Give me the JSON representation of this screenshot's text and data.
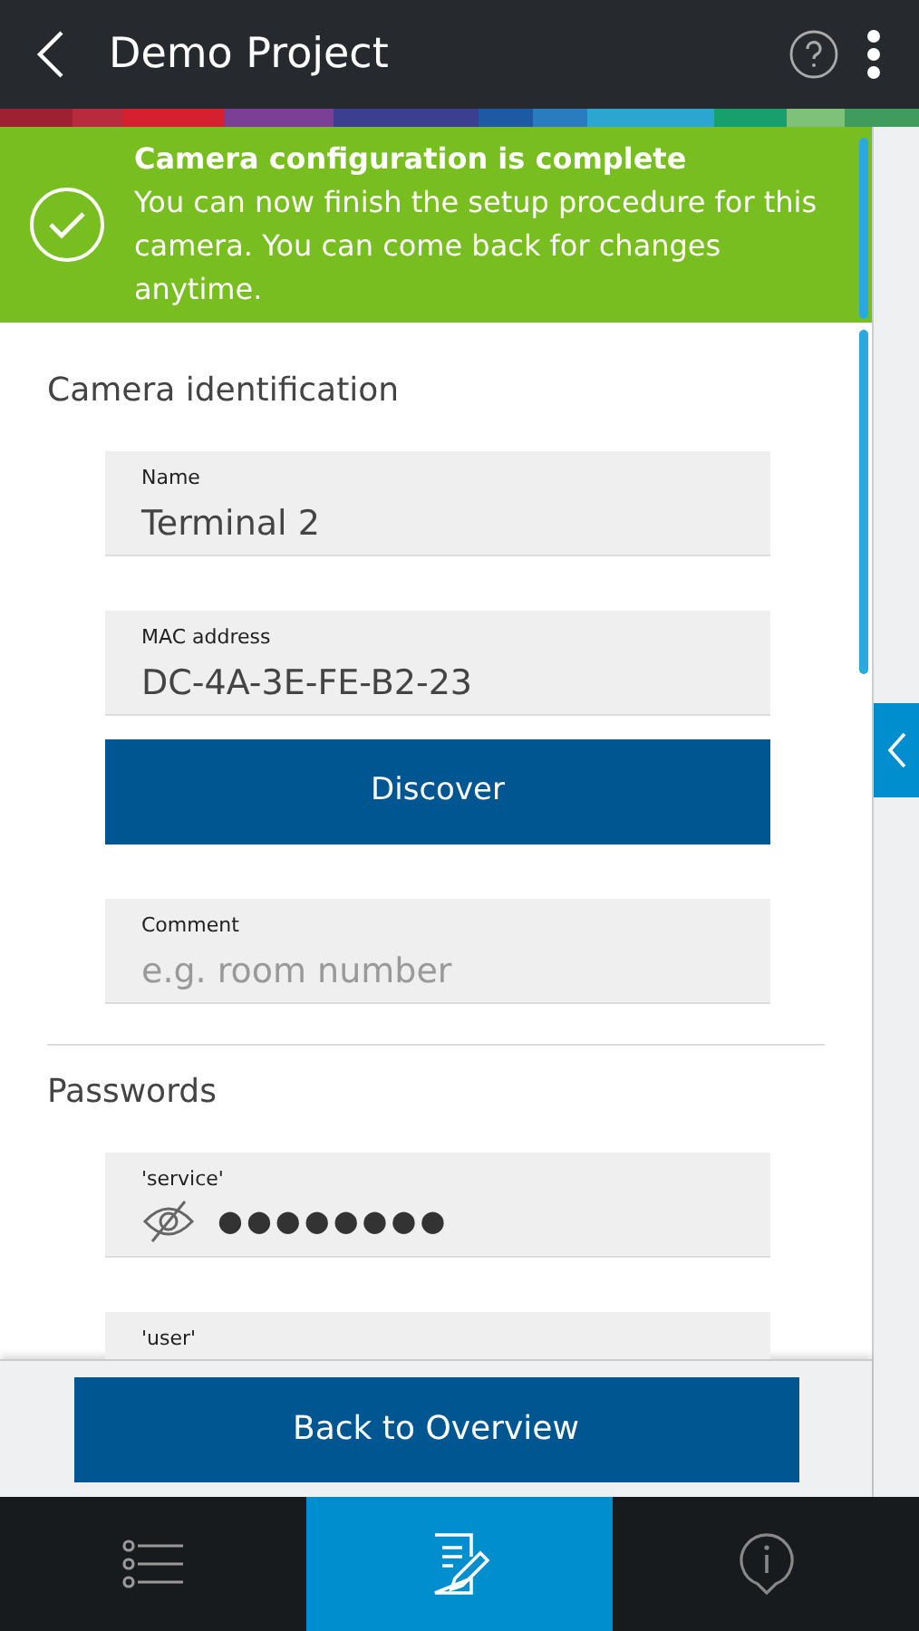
{
  "app_bar": {
    "title": "Demo Project"
  },
  "banner": {
    "title": "Camera configuration is complete",
    "message": "You can now finish the setup procedure for this camera. You can come back for changes anytime."
  },
  "sections": [
    {
      "heading": "Camera identification",
      "items": [
        {
          "kind": "field",
          "label": "Name",
          "value": "Terminal 2"
        },
        {
          "kind": "field",
          "label": "MAC address",
          "value": "DC-4A-3E-FE-B2-23"
        },
        {
          "kind": "button",
          "label": "Discover"
        },
        {
          "kind": "field",
          "label": "Comment",
          "placeholder": "e.g. room number"
        }
      ]
    },
    {
      "heading": "Passwords",
      "items": [
        {
          "kind": "password",
          "label": "'service'",
          "value": "●●●●●●●●"
        },
        {
          "kind": "password",
          "label": "'user'"
        }
      ]
    }
  ],
  "footer_button": "Back to Overview",
  "nav": [
    {
      "kind": "list",
      "selected": false
    },
    {
      "kind": "edit",
      "selected": true
    },
    {
      "kind": "info",
      "selected": false
    }
  ]
}
